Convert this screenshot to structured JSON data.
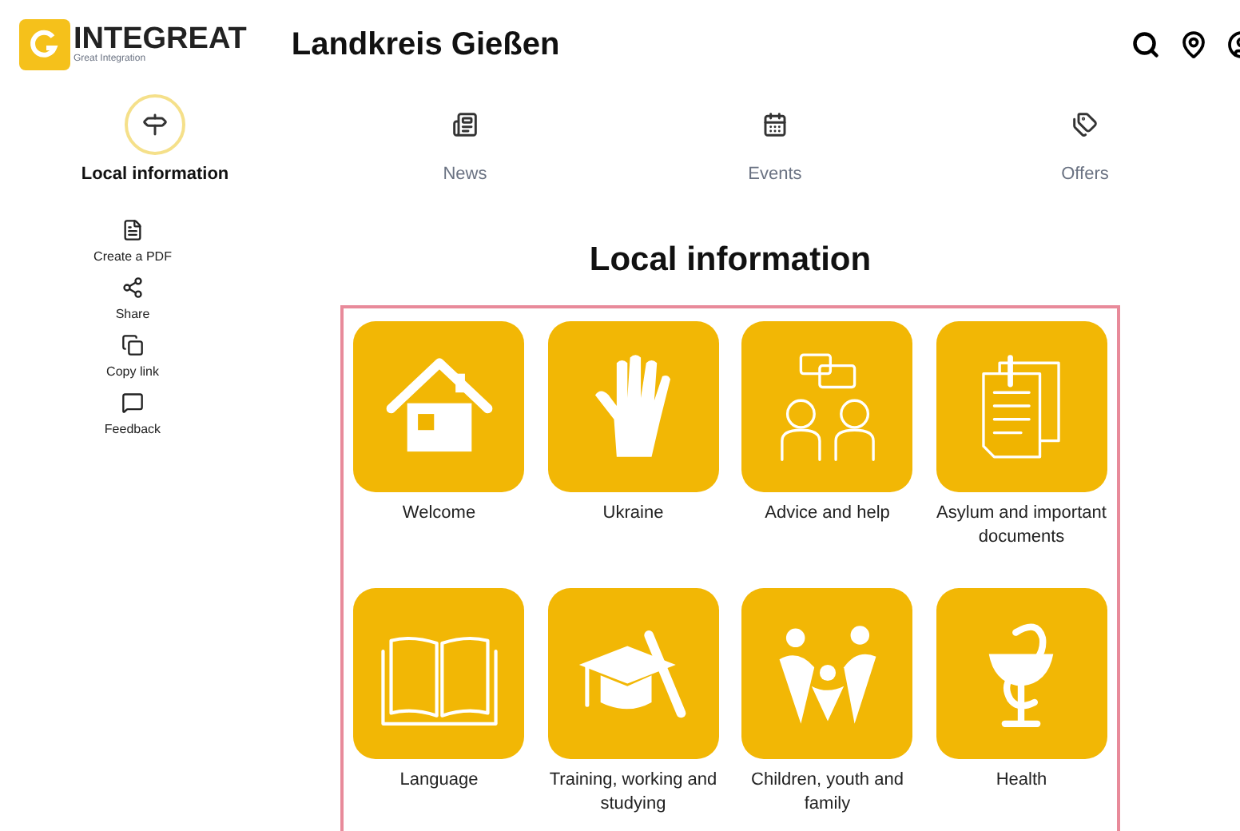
{
  "header": {
    "logo_text": "INTEGREAT",
    "logo_subtitle": "Great Integration",
    "region": "Landkreis Gießen"
  },
  "tabs": [
    {
      "label": "Local information",
      "selected": true
    },
    {
      "label": "News",
      "selected": false
    },
    {
      "label": "Events",
      "selected": false
    },
    {
      "label": "Offers",
      "selected": false
    }
  ],
  "toolbar": [
    {
      "label": "Create a PDF"
    },
    {
      "label": "Share"
    },
    {
      "label": "Copy link"
    },
    {
      "label": "Feedback"
    }
  ],
  "title": "Local information",
  "categories": [
    {
      "label": "Welcome"
    },
    {
      "label": "Ukraine"
    },
    {
      "label": "Advice and help"
    },
    {
      "label": "Asylum and important documents"
    },
    {
      "label": "Language"
    },
    {
      "label": "Training, working and studying"
    },
    {
      "label": "Children, youth and family"
    },
    {
      "label": "Health"
    }
  ]
}
